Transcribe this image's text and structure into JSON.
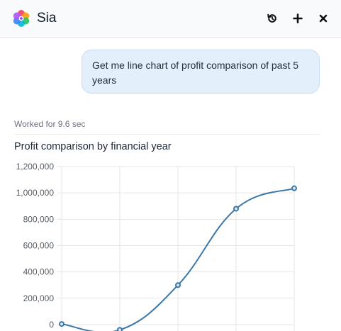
{
  "header": {
    "title": "Sia",
    "icons": {
      "logo": "flower-logo",
      "history": "history-icon",
      "new": "plus-icon",
      "close": "close-icon"
    }
  },
  "conversation": {
    "user_message": "Get me line chart of profit comparison of past 5 years",
    "status": "Worked for 9.6 sec",
    "chart_title": "Profit comparison by financial year"
  },
  "colors": {
    "line": "#3b77a8",
    "bubble": "#e3effa",
    "grid": "#e6e6e6"
  },
  "chart_data": {
    "type": "line",
    "title": "Profit comparison by financial year",
    "y_ticks": [
      "1,200,000",
      "1,000,000",
      "800,000",
      "600,000",
      "400,000",
      "200,000",
      "0"
    ],
    "ylim": [
      0,
      1200000
    ],
    "series": [
      {
        "values": [
          5000,
          -40000,
          300000,
          880000,
          1035000
        ]
      }
    ],
    "grid": true
  }
}
